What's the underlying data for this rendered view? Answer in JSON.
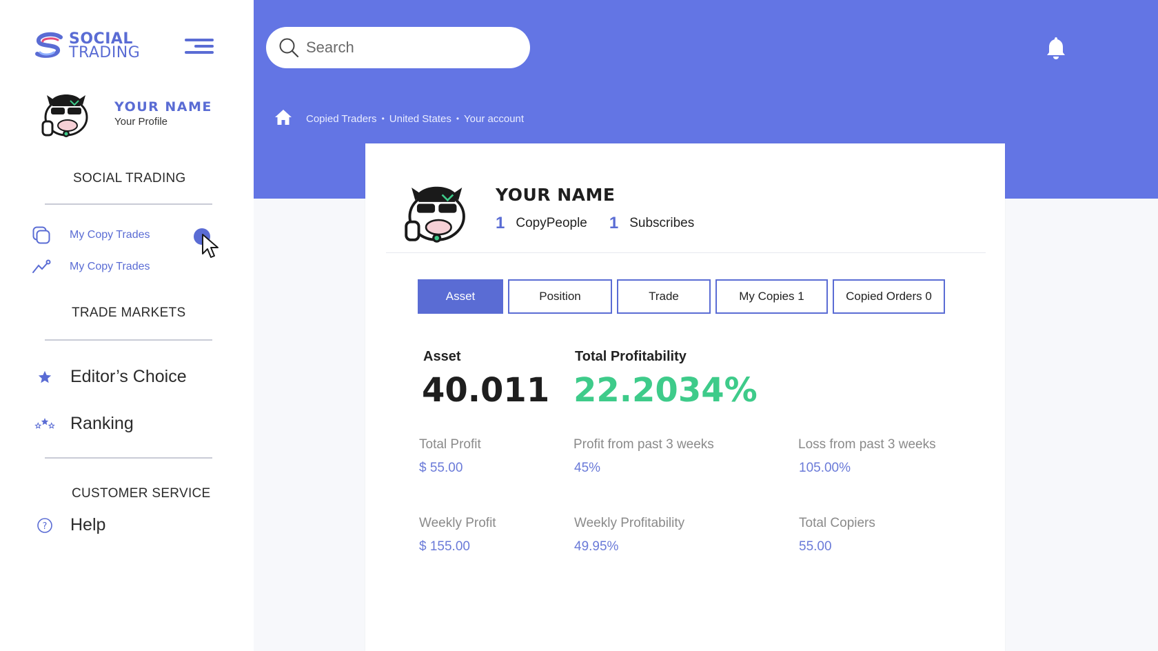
{
  "brand": {
    "line1": "SOCIAL",
    "line2": "TRADING"
  },
  "sidebar": {
    "profile_name": "YOUR NAME",
    "profile_sub": "Your Profile",
    "section_social": "SOCIAL TRADING",
    "copy_items": [
      {
        "label": "My Copy Trades",
        "icon": "copy-icon"
      },
      {
        "label": "My Copy Trades",
        "icon": "trend-icon"
      }
    ],
    "section_markets": "TRADE MARKETS",
    "market_items": [
      {
        "label": "Editor’s Choice",
        "icon": "star-icon"
      },
      {
        "label": "Ranking",
        "icon": "stars-icon"
      }
    ],
    "section_service": "CUSTOMER SERVICE",
    "help_label": "Help"
  },
  "header": {
    "search_placeholder": "Search",
    "breadcrumb": [
      "Copied Traders",
      "United States",
      "Your account"
    ],
    "separator": "•"
  },
  "card": {
    "name": "YOUR NAME",
    "copy_people_count": "1",
    "copy_people_label": "CopyPeople",
    "subscribes_count": "1",
    "subscribes_label": "Subscribes",
    "tabs": [
      "Asset",
      "Position",
      "Trade",
      "My Copies 1",
      "Copied Orders 0"
    ],
    "asset_label": "Asset",
    "asset_value": "40.011",
    "profitability_label": "Total Profitability",
    "profitability_value": "22.2034%",
    "stats": [
      {
        "label": "Total Profit",
        "value": "$ 55.00"
      },
      {
        "label": "Profit from past 3 weeks",
        "value": "45%"
      },
      {
        "label": "Loss from past 3 weeks",
        "value": "105.00%"
      },
      {
        "label": "Weekly Profit",
        "value": "$ 155.00"
      },
      {
        "label": "Weekly Profitability",
        "value": "49.95%"
      },
      {
        "label": "Total Copiers",
        "value": "55.00"
      }
    ]
  },
  "colors": {
    "primary": "#6375e4",
    "accent": "#5a6cd4",
    "positive": "#3ecb8a"
  }
}
